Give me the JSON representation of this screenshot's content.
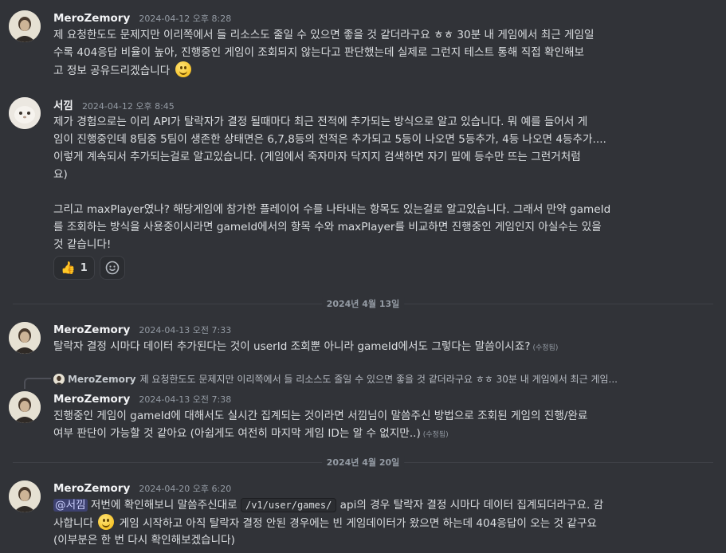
{
  "messages": {
    "m1": {
      "username": "MeroZemory",
      "timestamp": "2024-04-12 오후 8:28",
      "lines": [
        "제 요청한도도 문제지만 이리쪽에서 들 리소스도 줄일 수 있으면 좋을 것 같더라구요 ㅎㅎ 30분 내 게임에서 최근 게임일",
        "수록 404응답 비율이 높아, 진행중인 게임이 조회되지 않는다고 판단했는데 실제로 그런지 테스트 통해 직접 확인해보",
        "고 정보 공유드리겠습니다"
      ]
    },
    "m2": {
      "username": "서낌",
      "timestamp": "2024-04-12 오후 8:45",
      "lines": [
        "제가 경험으로는 이리 API가 탈락자가 결정 될때마다 최근 전적에 추가되는 방식으로 알고 있습니다. 뭐 예를 들어서 게",
        "임이 진행중인데 8팀중 5팀이 생존한 상태면은 6,7,8등의 전적은 추가되고 5등이 나오면 5등추가, 4등 나오면 4등추가....",
        "이렇게 계속되서 추가되는걸로 알고있습니다. (게임에서 죽자마자 닥지지 검색하면 자기 밑에 등수만 뜨는 그런거처럼",
        "요)",
        "",
        "그리고 maxPlayer였나? 해당게임에 참가한 플레이어 수를 나타내는 항목도 있는걸로 알고있습니다. 그래서 만약 gameId",
        "를 조회하는 방식을 사용중이시라면 gameId에서의 항목 수와 maxPlayer를 비교하면 진행중인 게임인지 아실수는 있을",
        "것 같습니다!"
      ],
      "reaction_count": "1"
    },
    "divider1": "2024년 4월 13일",
    "m3": {
      "username": "MeroZemory",
      "timestamp": "2024-04-13 오전 7:33",
      "text": "탈락자 결정 시마다 데이터 추가된다는 것이 userId 조회뿐 아니라 gameId에서도 그렇다는 말씀이시죠?",
      "edited": "(수정됨)"
    },
    "reply": {
      "name": "MeroZemory",
      "text": "제 요청한도도 문제지만 이리쪽에서 들 리소스도 줄일 수 있으면 좋을 것 같더라구요 ㅎㅎ 30분 내 게임에서 최근 게임..."
    },
    "m4": {
      "username": "MeroZemory",
      "timestamp": "2024-04-13 오전 7:38",
      "lines": [
        "진행중인 게임이 gameId에 대해서도 실시간 집계되는 것이라면 서낌님이 말씀주신 방법으로 조회된 게임의 진행/완료",
        "여부 판단이 가능할 것 같아요 (아쉽게도 여전히 마지막 게임 ID는 알 수 없지만..)"
      ],
      "edited": "(수정됨)"
    },
    "divider2": "2024년 4월 20일",
    "m5": {
      "username": "MeroZemory",
      "timestamp": "2024-04-20 오후 6:20",
      "mention": "@서낌",
      "l1_a": " 저번에 확인해보니 말씀주신대로 ",
      "code": "/v1/user/games/",
      "l1_b": " api의 경우 탈락자 결정 시마다 데이터 집계되더라구요. 감",
      "l2_a": "사합니다 ",
      "l2_b": " 게임 시작하고 아직 탈락자 결정 안된 경우에는 빈 게임데이터가 왔으면 하는데 404응답이 오는 것 같구요",
      "l3": "(이부분은 한 번 다시 확인해보겠습니다)"
    }
  },
  "colors": {
    "background": "#313338",
    "username": "#f2f3f5",
    "text": "#dbdee1",
    "muted": "#949ba4"
  }
}
